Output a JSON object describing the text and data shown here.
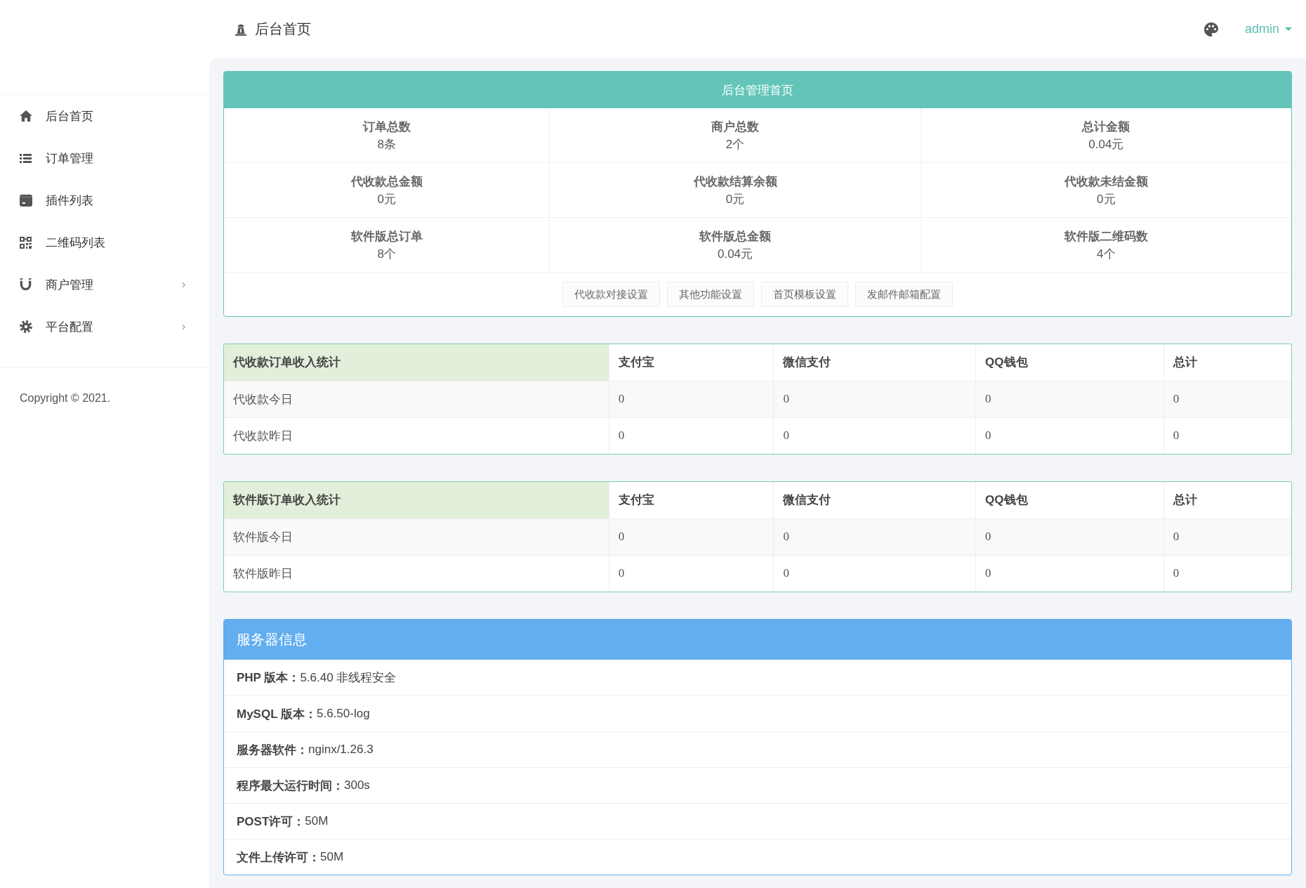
{
  "sidebar": {
    "items": [
      {
        "label": "后台首页",
        "kind": "link"
      },
      {
        "label": "订单管理",
        "kind": "link"
      },
      {
        "label": "插件列表",
        "kind": "link"
      },
      {
        "label": "二维码列表",
        "kind": "link"
      },
      {
        "label": "商户管理",
        "kind": "submenu"
      },
      {
        "label": "平台配置",
        "kind": "submenu"
      }
    ],
    "copyright": "Copyright © 2021."
  },
  "topbar": {
    "title": "后台首页",
    "user": "admin"
  },
  "overview": {
    "title": "后台管理首页",
    "stats": [
      [
        {
          "label": "订单总数",
          "value": "8条"
        },
        {
          "label": "商户总数",
          "value": "2个"
        },
        {
          "label": "总计金额",
          "value": "0.04元"
        }
      ],
      [
        {
          "label": "代收款总金额",
          "value": "0元"
        },
        {
          "label": "代收款结算余额",
          "value": "0元"
        },
        {
          "label": "代收款未结金额",
          "value": "0元"
        }
      ],
      [
        {
          "label": "软件版总订单",
          "value": "8个"
        },
        {
          "label": "软件版总金额",
          "value": "0.04元"
        },
        {
          "label": "软件版二维码数",
          "value": "4个"
        }
      ]
    ],
    "buttons": [
      "代收款对接设置",
      "其他功能设置",
      "首页模板设置",
      "发邮件邮箱配置"
    ]
  },
  "income_tables": [
    {
      "columns": [
        "代收款订单收入统计",
        "支付宝",
        "微信支付",
        "QQ钱包",
        "总计"
      ],
      "rows": [
        [
          "代收款今日",
          "0",
          "0",
          "0",
          "0"
        ],
        [
          "代收款昨日",
          "0",
          "0",
          "0",
          "0"
        ]
      ]
    },
    {
      "columns": [
        "软件版订单收入统计",
        "支付宝",
        "微信支付",
        "QQ钱包",
        "总计"
      ],
      "rows": [
        [
          "软件版今日",
          "0",
          "0",
          "0",
          "0"
        ],
        [
          "软件版昨日",
          "0",
          "0",
          "0",
          "0"
        ]
      ]
    }
  ],
  "server_info": {
    "title": "服务器信息",
    "rows": [
      {
        "label": "PHP 版本：",
        "value": "5.6.40 非线程安全"
      },
      {
        "label": "MySQL 版本：",
        "value": "5.6.50-log"
      },
      {
        "label": "服务器软件：",
        "value": "nginx/1.26.3"
      },
      {
        "label": "程序最大运行时间：",
        "value": "300s"
      },
      {
        "label": "POST许可：",
        "value": "50M"
      },
      {
        "label": "文件上传许可：",
        "value": "50M"
      }
    ]
  }
}
